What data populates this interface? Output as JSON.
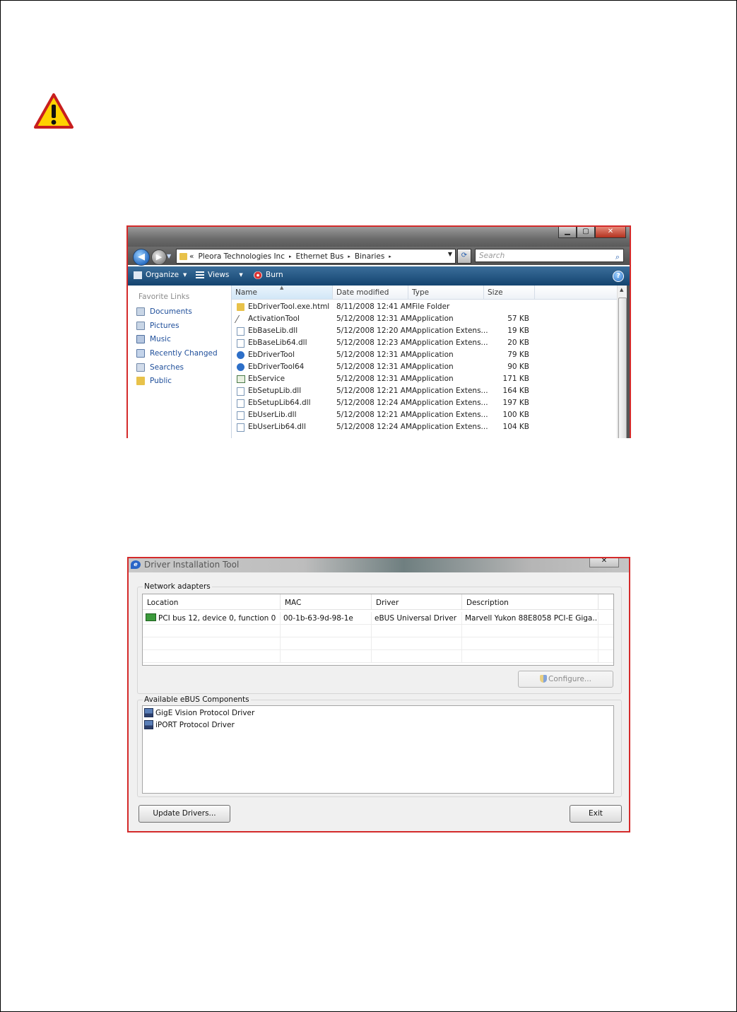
{
  "colors": {
    "screenshot_border": "#d42a2a",
    "link_blue": "#1e4e9a",
    "toolbar_blue": "#14446f",
    "warning_yellow": "#ffd200"
  },
  "warning": {
    "icon": "warning-triangle-icon"
  },
  "explorer": {
    "window_buttons": {
      "minimize": "▁",
      "maximize": "▢",
      "close": "✕"
    },
    "address": {
      "overflow": "«",
      "crumbs": [
        "Pleora Technologies Inc",
        "Ethernet Bus",
        "Binaries"
      ],
      "sep": "▸"
    },
    "search_placeholder": "Search",
    "toolbar": {
      "organize": "Organize",
      "views": "Views",
      "burn": "Burn"
    },
    "favorite_links": {
      "heading": "Favorite Links",
      "items": [
        "Documents",
        "Pictures",
        "Music",
        "Recently Changed",
        "Searches",
        "Public"
      ]
    },
    "columns": [
      "Name",
      "Date modified",
      "Type",
      "Size"
    ],
    "files": [
      {
        "name": "EbDriverTool.exe.html",
        "date": "8/11/2008 12:41 AM",
        "type": "File Folder",
        "size": "",
        "icon": "folder"
      },
      {
        "name": "ActivationTool",
        "date": "5/12/2008 12:31 AM",
        "type": "Application",
        "size": "57 KB",
        "icon": "tool"
      },
      {
        "name": "EbBaseLib.dll",
        "date": "5/12/2008 12:20 AM",
        "type": "Application Extens...",
        "size": "19 KB",
        "icon": "dll"
      },
      {
        "name": "EbBaseLib64.dll",
        "date": "5/12/2008 12:23 AM",
        "type": "Application Extens...",
        "size": "20 KB",
        "icon": "dll"
      },
      {
        "name": "EbDriverTool",
        "date": "5/12/2008 12:31 AM",
        "type": "Application",
        "size": "79 KB",
        "icon": "app"
      },
      {
        "name": "EbDriverTool64",
        "date": "5/12/2008 12:31 AM",
        "type": "Application",
        "size": "90 KB",
        "icon": "app"
      },
      {
        "name": "EbService",
        "date": "5/12/2008 12:31 AM",
        "type": "Application",
        "size": "171 KB",
        "icon": "svc"
      },
      {
        "name": "EbSetupLib.dll",
        "date": "5/12/2008 12:21 AM",
        "type": "Application Extens...",
        "size": "164 KB",
        "icon": "dll"
      },
      {
        "name": "EbSetupLib64.dll",
        "date": "5/12/2008 12:24 AM",
        "type": "Application Extens...",
        "size": "197 KB",
        "icon": "dll"
      },
      {
        "name": "EbUserLib.dll",
        "date": "5/12/2008 12:21 AM",
        "type": "Application Extens...",
        "size": "100 KB",
        "icon": "dll"
      },
      {
        "name": "EbUserLib64.dll",
        "date": "5/12/2008 12:24 AM",
        "type": "Application Extens...",
        "size": "104 KB",
        "icon": "dll"
      }
    ]
  },
  "driver_tool": {
    "title": "Driver Installation Tool",
    "logo": "e",
    "close": "✕",
    "network_group": "Network adapters",
    "columns": [
      "Location",
      "MAC",
      "Driver",
      "Description"
    ],
    "adapters": [
      {
        "location": "PCI bus 12, device 0, function 0",
        "mac": "00-1b-63-9d-98-1e",
        "driver": "eBUS Universal Driver",
        "description": "Marvell Yukon 88E8058 PCI-E Giga..."
      }
    ],
    "configure_button": "Configure...",
    "components_group": "Available eBUS Components",
    "components": [
      "GigE Vision Protocol Driver",
      "iPORT Protocol Driver"
    ],
    "update_button": "Update Drivers...",
    "exit_button": "Exit"
  }
}
